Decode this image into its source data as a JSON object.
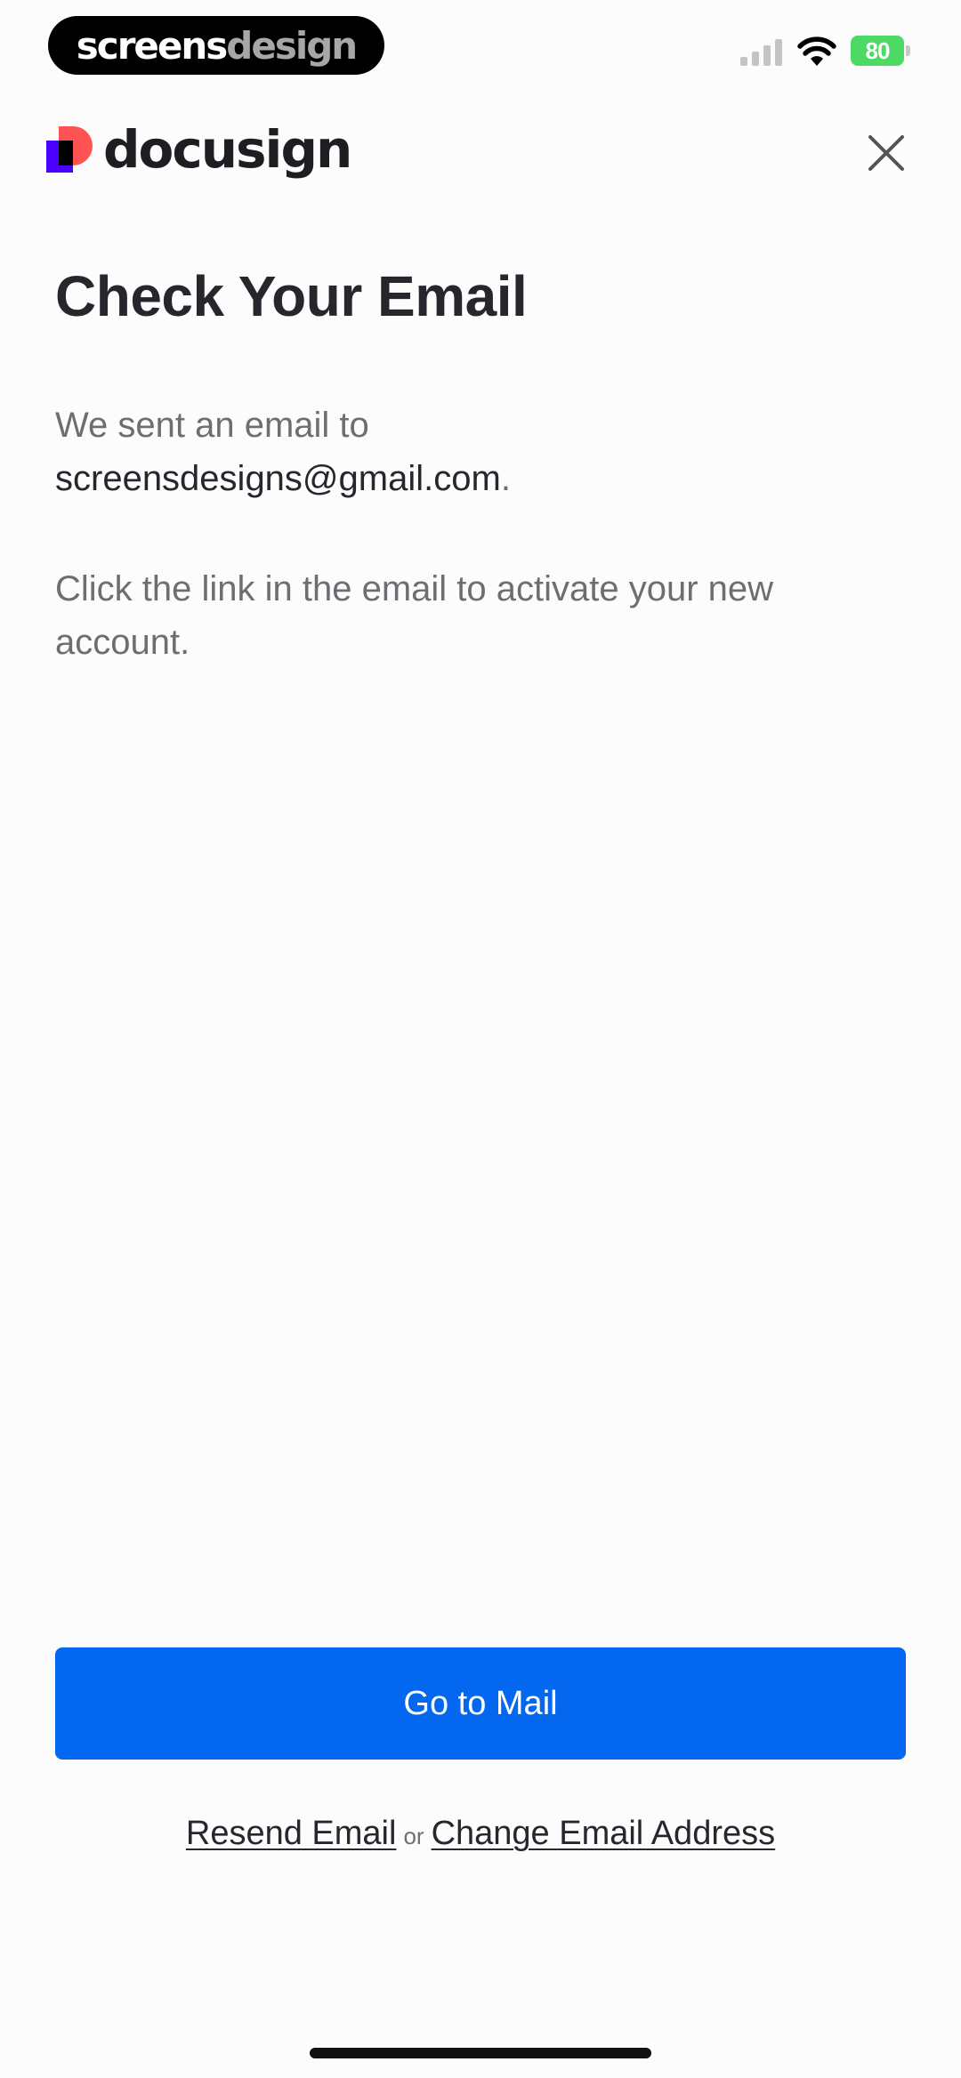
{
  "status_bar": {
    "brand_part1": "screens",
    "brand_part2": "design",
    "battery_level": "80"
  },
  "header": {
    "logo_text": "docusign",
    "close_icon": "close-icon"
  },
  "main": {
    "title": "Check Your Email",
    "sent_prefix": "We sent an email to",
    "email": "screensdesigns@gmail.com",
    "email_suffix": ".",
    "instruction": "Click the link in the email to activate your new account."
  },
  "actions": {
    "go_to_mail_label": "Go to Mail",
    "resend_label": "Resend Email",
    "or_label": "or",
    "change_email_label": "Change Email Address"
  },
  "colors": {
    "primary": "#0467ef",
    "text": "#26262d",
    "muted_text": "#6e6e72",
    "background": "#fdfcfd",
    "battery": "#4cd964"
  }
}
